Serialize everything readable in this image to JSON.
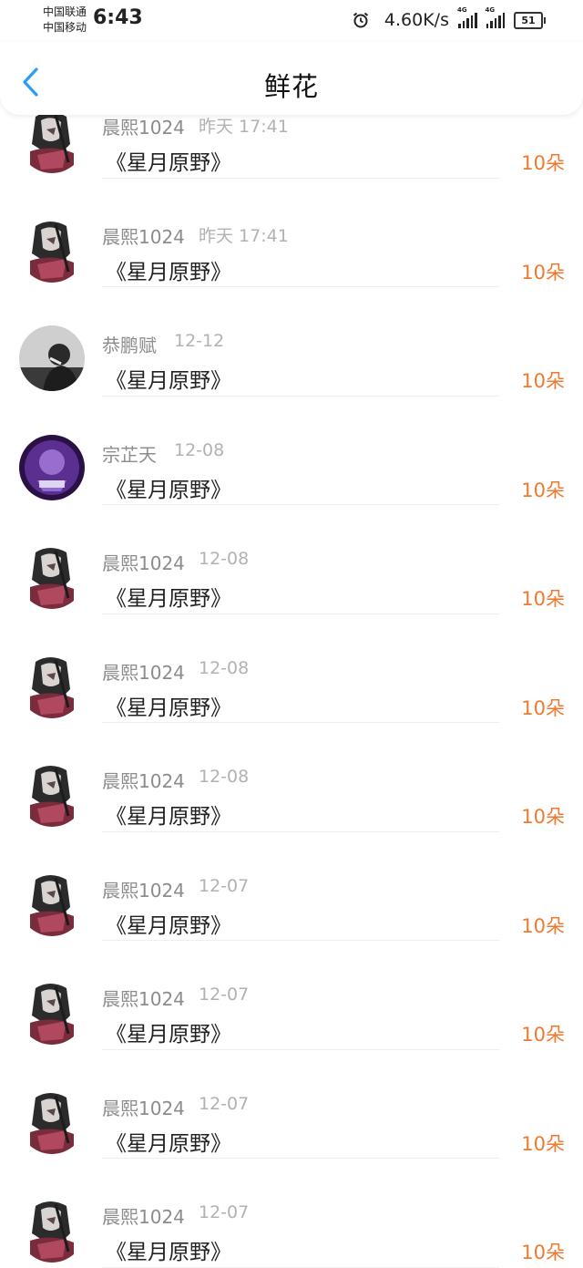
{
  "status_bar": {
    "carrier_1": "中国联通",
    "carrier_2": "中国移动",
    "time": "6:43",
    "net_speed": "4.60K/s",
    "network_1": "4G",
    "network_2": "4G",
    "battery": "51"
  },
  "nav": {
    "title": "鲜花"
  },
  "records": [
    {
      "user": "晨熙1024",
      "time": "昨天 17:41",
      "book": "《星月原野》",
      "amount": "10朵",
      "avatar": "anime-girl"
    },
    {
      "user": "晨熙1024",
      "time": "昨天 17:41",
      "book": "《星月原野》",
      "amount": "10朵",
      "avatar": "anime-girl"
    },
    {
      "user": "恭鹏赋",
      "time": "12-12",
      "book": "《星月原野》",
      "amount": "10朵",
      "avatar": "mono-photo"
    },
    {
      "user": "宗芷天",
      "time": "12-08",
      "book": "《星月原野》",
      "amount": "10朵",
      "avatar": "purple-art"
    },
    {
      "user": "晨熙1024",
      "time": "12-08",
      "book": "《星月原野》",
      "amount": "10朵",
      "avatar": "anime-girl"
    },
    {
      "user": "晨熙1024",
      "time": "12-08",
      "book": "《星月原野》",
      "amount": "10朵",
      "avatar": "anime-girl"
    },
    {
      "user": "晨熙1024",
      "time": "12-08",
      "book": "《星月原野》",
      "amount": "10朵",
      "avatar": "anime-girl"
    },
    {
      "user": "晨熙1024",
      "time": "12-07",
      "book": "《星月原野》",
      "amount": "10朵",
      "avatar": "anime-girl"
    },
    {
      "user": "晨熙1024",
      "time": "12-07",
      "book": "《星月原野》",
      "amount": "10朵",
      "avatar": "anime-girl"
    },
    {
      "user": "晨熙1024",
      "time": "12-07",
      "book": "《星月原野》",
      "amount": "10朵",
      "avatar": "anime-girl"
    },
    {
      "user": "晨熙1024",
      "time": "12-07",
      "book": "《星月原野》",
      "amount": "10朵",
      "avatar": "anime-girl"
    }
  ],
  "colors": {
    "accent": "#ef7a2f",
    "back_arrow": "#2a9df4"
  }
}
